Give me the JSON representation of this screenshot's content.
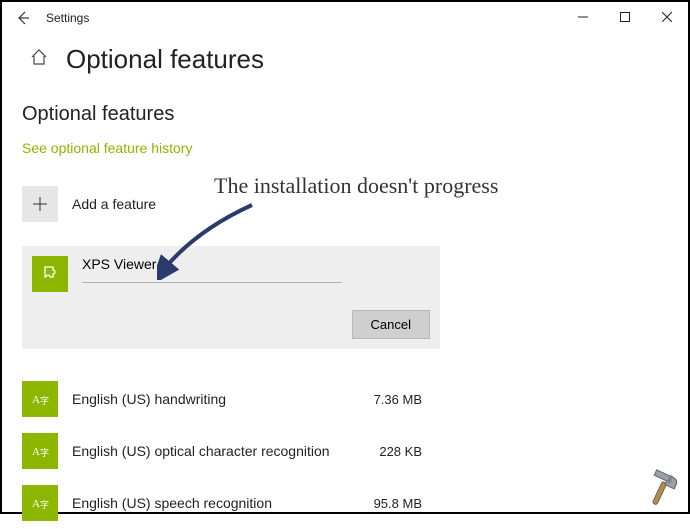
{
  "window": {
    "title": "Settings"
  },
  "header": {
    "page_title": "Optional features"
  },
  "section_title": "Optional features",
  "history_link": "See optional feature history",
  "add_feature": {
    "label": "Add a feature"
  },
  "installing": {
    "name": "XPS Viewer",
    "cancel_label": "Cancel"
  },
  "features": [
    {
      "name": "English (US) handwriting",
      "size": "7.36 MB"
    },
    {
      "name": "English (US) optical character recognition",
      "size": "228 KB"
    },
    {
      "name": "English (US) speech recognition",
      "size": "95.8 MB"
    }
  ],
  "annotation": "The installation doesn't progress"
}
